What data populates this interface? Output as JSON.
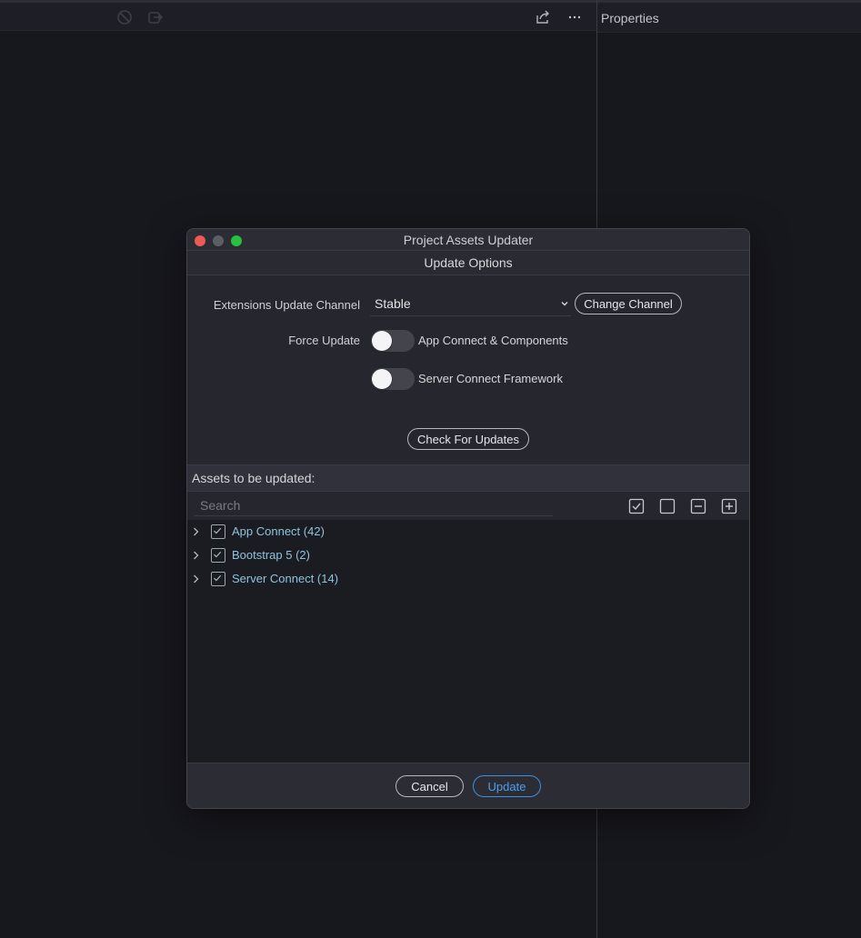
{
  "background": {
    "properties_title": "Properties"
  },
  "dialog": {
    "window_title": "Project Assets Updater",
    "section_title": "Update Options",
    "channel": {
      "label": "Extensions Update Channel",
      "value": "Stable",
      "change_button": "Change Channel"
    },
    "force_update": {
      "label": "Force Update",
      "toggles": [
        {
          "label": "App Connect & Components",
          "on": false
        },
        {
          "label": "Server Connect Framework",
          "on": false
        }
      ]
    },
    "check_button": "Check For Updates",
    "assets_header": "Assets to be updated:",
    "search_placeholder": "Search",
    "assets": [
      {
        "label": "App Connect (42)",
        "checked": true
      },
      {
        "label": "Bootstrap 5 (2)",
        "checked": true
      },
      {
        "label": "Server Connect (14)",
        "checked": true
      }
    ],
    "cancel_button": "Cancel",
    "update_button": "Update"
  },
  "colors": {
    "accent": "#3d8fe0",
    "asset_text": "#8ec4de",
    "close": "#ed5a55",
    "maximize": "#27c03f"
  }
}
